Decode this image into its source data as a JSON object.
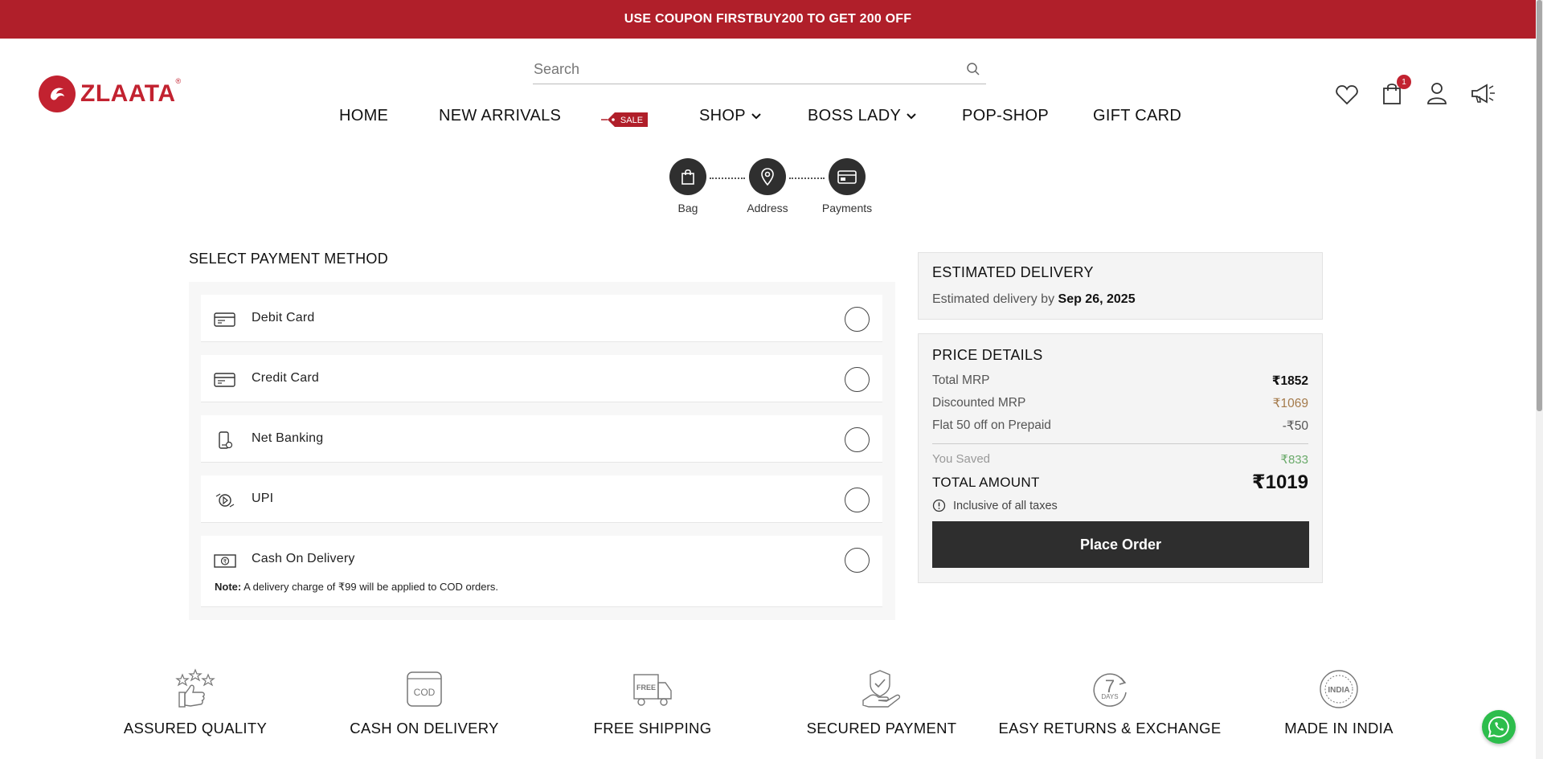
{
  "promo": {
    "text": "USE COUPON FIRSTBUY200 TO GET 200 OFF"
  },
  "brand": {
    "name": "ZLAATA",
    "registered": "®"
  },
  "search": {
    "placeholder": "Search"
  },
  "nav": {
    "items": [
      {
        "label": "HOME"
      },
      {
        "label": "NEW ARRIVALS"
      },
      {
        "label": "SALE"
      },
      {
        "label": "SHOP",
        "icon": "chevron-down-icon"
      },
      {
        "label": "BOSS LADY",
        "icon": "chevron-down-icon"
      },
      {
        "label": "POP-SHOP"
      },
      {
        "label": "GIFT CARD"
      }
    ]
  },
  "header_icons": {
    "wishlist": "heart-icon",
    "cart": "shopping-bag-icon",
    "cart_count": "1",
    "account": "user-icon",
    "announcements": "megaphone-icon"
  },
  "checkout_steps": [
    {
      "label": "Bag",
      "icon": "shopping-bag-icon"
    },
    {
      "label": "Address",
      "icon": "map-pin-icon"
    },
    {
      "label": "Payments",
      "icon": "payment-card-icon"
    }
  ],
  "payment": {
    "title": "SELECT PAYMENT METHOD",
    "methods": [
      {
        "label": "Debit Card",
        "icon": "debit-card-icon"
      },
      {
        "label": "Credit Card",
        "icon": "credit-card-icon"
      },
      {
        "label": "Net Banking",
        "icon": "net-banking-icon"
      },
      {
        "label": "UPI",
        "icon": "upi-icon"
      },
      {
        "label": "Cash On Delivery",
        "icon": "cash-icon"
      }
    ],
    "cod_note_label": "Note:",
    "cod_note_text": " A delivery charge of ₹99 will be applied to COD orders."
  },
  "delivery": {
    "title": "ESTIMATED DELIVERY",
    "prefix": "Estimated delivery by",
    "date": "Sep 26, 2025"
  },
  "price": {
    "title": "PRICE DETAILS",
    "total_mrp_label": "Total MRP",
    "total_mrp": "₹1852",
    "discounted_mrp_label": "Discounted MRP",
    "discounted_mrp": "₹1069",
    "prepaid_label": "Flat 50 off on Prepaid",
    "prepaid_value": "-₹50",
    "saved_label": "You Saved",
    "saved_value": "₹833",
    "total_label": "TOTAL AMOUNT",
    "total_value": "₹1019",
    "tax_note": "Inclusive of all taxes",
    "place_order": "Place Order"
  },
  "colors": {
    "brand_red": "#b01f2a",
    "discount_brown": "#a47a4b",
    "saved_green": "#6aaa6a",
    "dark_button": "#2e2e2e"
  },
  "features": [
    {
      "label": "ASSURED QUALITY",
      "icon": "thumbs-up-stars-icon"
    },
    {
      "label": "CASH ON DELIVERY",
      "icon": "cod-icon",
      "icon_text": "COD"
    },
    {
      "label": "FREE SHIPPING",
      "icon": "delivery-truck-icon",
      "icon_text": "FREE"
    },
    {
      "label": "SECURED PAYMENT",
      "icon": "secure-payment-icon"
    },
    {
      "label": "EASY RETURNS & EXCHANGE",
      "icon": "seven-days-icon",
      "icon_text": "7",
      "icon_subtext": "DAYS"
    },
    {
      "label": "MADE IN INDIA",
      "icon": "india-seal-icon",
      "icon_text": "INDIA"
    }
  ]
}
